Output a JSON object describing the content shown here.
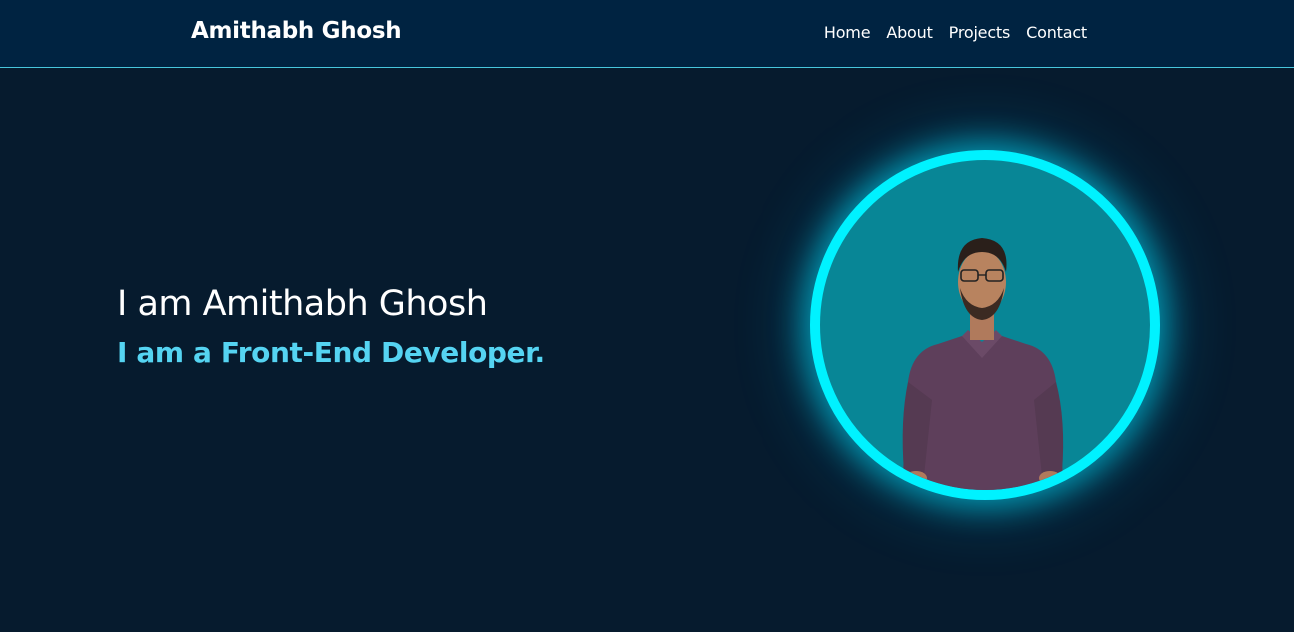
{
  "header": {
    "brand": "Amithabh Ghosh",
    "nav": [
      "Home",
      "About",
      "Projects",
      "Contact"
    ]
  },
  "hero": {
    "intro": "I am Amithabh Ghosh",
    "role": "I am a Front-End Developer."
  },
  "colors": {
    "header_bg": "#002341",
    "page_bg": "#061b2e",
    "accent": "#55d4f2",
    "ring": "#00f2ff",
    "photo_bg": "#088696"
  },
  "icons": {
    "profile_photo": "person-portrait"
  }
}
